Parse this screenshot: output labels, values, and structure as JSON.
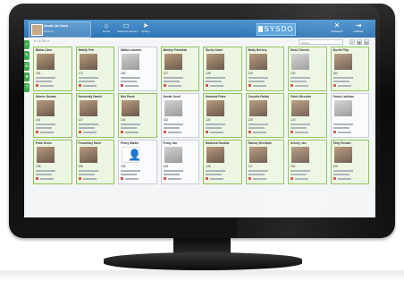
{
  "app": {
    "brand": "SYSDO"
  },
  "user": {
    "name": "Novák Jan Karel",
    "role": "Správce"
  },
  "nav": [
    {
      "label": "Home",
      "icon": "home-icon",
      "glyph": "⌂"
    },
    {
      "label": "Telefonní seznam",
      "icon": "monitor-icon",
      "glyph": "▭"
    },
    {
      "label": "Zprávy",
      "icon": "send-icon",
      "glyph": "➤"
    },
    {
      "label": "Nastavení",
      "icon": "tools-icon",
      "glyph": "✕"
    },
    {
      "label": "Odhlásit",
      "icon": "logout-icon",
      "glyph": "⇥"
    }
  ],
  "toolbar": {
    "pager": "« ‹  1 / 3  › »",
    "search_placeholder": "Hledat..."
  },
  "people": [
    {
      "name": "Bláha Libor",
      "phone": "161",
      "photo": "color",
      "status": "on"
    },
    {
      "name": "Matějů Petr",
      "phone": "171",
      "photo": "color",
      "status": "on"
    },
    {
      "name": "Málka Lubomír",
      "phone": "150",
      "photo": "gray",
      "status": "off"
    },
    {
      "name": "Mašíný František",
      "phone": "127",
      "photo": "color",
      "status": "on"
    },
    {
      "name": "Šuchý Karel",
      "phone": "128",
      "photo": "color",
      "status": "on"
    },
    {
      "name": "Mrály Bořivoj",
      "phone": "129",
      "photo": "color",
      "status": "on"
    },
    {
      "name": "Musil Zdeněk",
      "phone": "130",
      "photo": "gray",
      "status": "on"
    },
    {
      "name": "Mysliš Filip",
      "phone": "164",
      "photo": "color",
      "status": "on"
    },
    {
      "name": "Němec Gustav",
      "phone": "241",
      "photo": "color",
      "status": "on"
    },
    {
      "name": "Nerlovský Daniel",
      "phone": "127",
      "photo": "color",
      "status": "on"
    },
    {
      "name": "Nóž Pavel",
      "phone": "134",
      "photo": "color",
      "status": "on"
    },
    {
      "name": "Novák Josef",
      "phone": "132",
      "photo": "gray",
      "status": "off"
    },
    {
      "name": "Novotná Petra",
      "phone": "120",
      "photo": "color",
      "status": "on"
    },
    {
      "name": "Onyašík Radka",
      "phone": "125",
      "photo": "color",
      "status": "on"
    },
    {
      "name": "Pátek Miroslav",
      "phone": "120",
      "photo": "color",
      "status": "on"
    },
    {
      "name": "Pavka Ladislav",
      "phone": "",
      "photo": "gray",
      "status": "off"
    },
    {
      "name": "Polle Denis",
      "phone": "128",
      "photo": "color",
      "status": "on"
    },
    {
      "name": "Prouzlický Karel",
      "phone": "190",
      "photo": "color",
      "status": "on"
    },
    {
      "name": "Přímý Martin",
      "phone": "195",
      "photo": "none",
      "status": "off"
    },
    {
      "name": "Pumy Jan",
      "phone": "128",
      "photo": "gray",
      "status": "off"
    },
    {
      "name": "Rašková Daniela",
      "phone": "128",
      "photo": "color",
      "status": "on"
    },
    {
      "name": "Šammy Břetislav",
      "phone": "117",
      "photo": "color",
      "status": "on"
    },
    {
      "name": "Sekory Jan",
      "phone": "202",
      "photo": "color",
      "status": "on"
    },
    {
      "name": "Šímy Roman",
      "phone": "106",
      "photo": "color",
      "status": "on"
    }
  ],
  "colors": {
    "header": "#3b84c3",
    "online_border": "#8ec35a",
    "online_bg": "#edf6e2",
    "offline_bg": "#fafbfc"
  }
}
